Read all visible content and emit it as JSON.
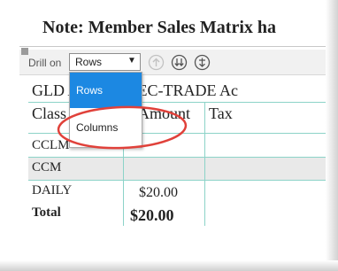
{
  "note": {
    "title": "Note: Member Sales Matrix ha"
  },
  "toolbar": {
    "drill_label": "Drill on",
    "drill_select": {
      "value": "Rows",
      "options": [
        "Rows",
        "Columns"
      ],
      "selected": "Rows"
    },
    "icons": [
      "drill-up-icon",
      "drill-down-icon",
      "drill-through-icon"
    ]
  },
  "report": {
    "title": "GLD ACCTS. REC-TRADE Ac",
    "headers": [
      "Class",
      "Amount",
      "Tax"
    ],
    "rows": [
      {
        "label": "CCLM",
        "amount": ""
      },
      {
        "label": "CCM",
        "amount": ""
      },
      {
        "label": "DAILY",
        "amount": "$20.00"
      }
    ],
    "total": {
      "label": "Total",
      "amount": "$20.00"
    }
  },
  "colors": {
    "accent": "#1c88e2",
    "grid_line": "#8cd3c8",
    "annotation": "#e0413a"
  }
}
